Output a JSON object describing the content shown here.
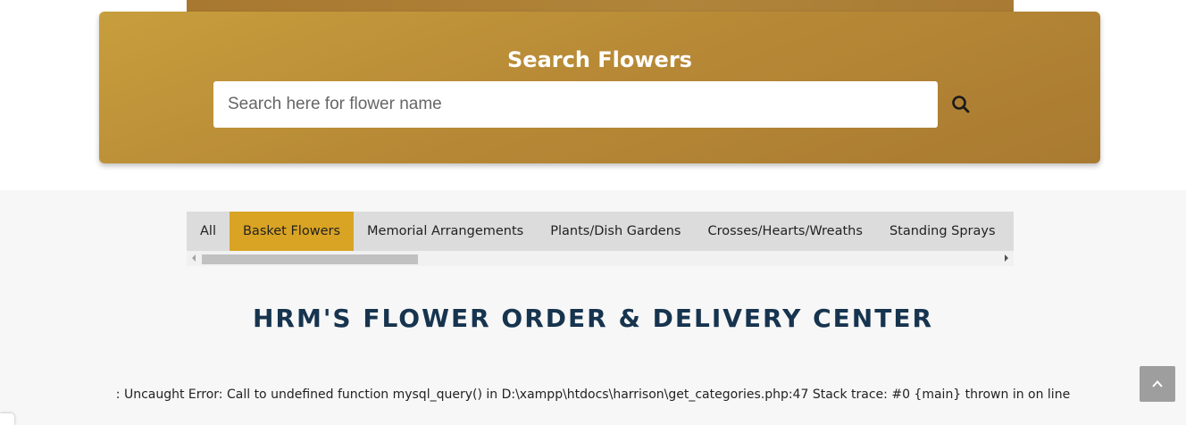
{
  "search": {
    "title": "Search Flowers",
    "placeholder": "Search here for flower name",
    "value": "",
    "button_icon": "search-icon"
  },
  "categories": {
    "active": "Basket Flowers",
    "active_color": "#d9a424",
    "tabs": [
      "All",
      "Basket Flowers",
      "Memorial Arrangements",
      "Plants/Dish Gardens",
      "Crosses/Hearts/Wreaths",
      "Standing Sprays"
    ]
  },
  "main": {
    "heading": "HRM'S FLOWER ORDER & DELIVERY CENTER",
    "error": ": Uncaught Error: Call to undefined function mysql_query() in D:\\xampp\\htdocs\\harrison\\get_categories.php:47 Stack trace: #0 {main} thrown in on line"
  },
  "back_to_top": {
    "icon": "chevron-up-icon"
  },
  "colors": {
    "panel_gold": "#b88a36",
    "heading_navy": "#17344f"
  }
}
